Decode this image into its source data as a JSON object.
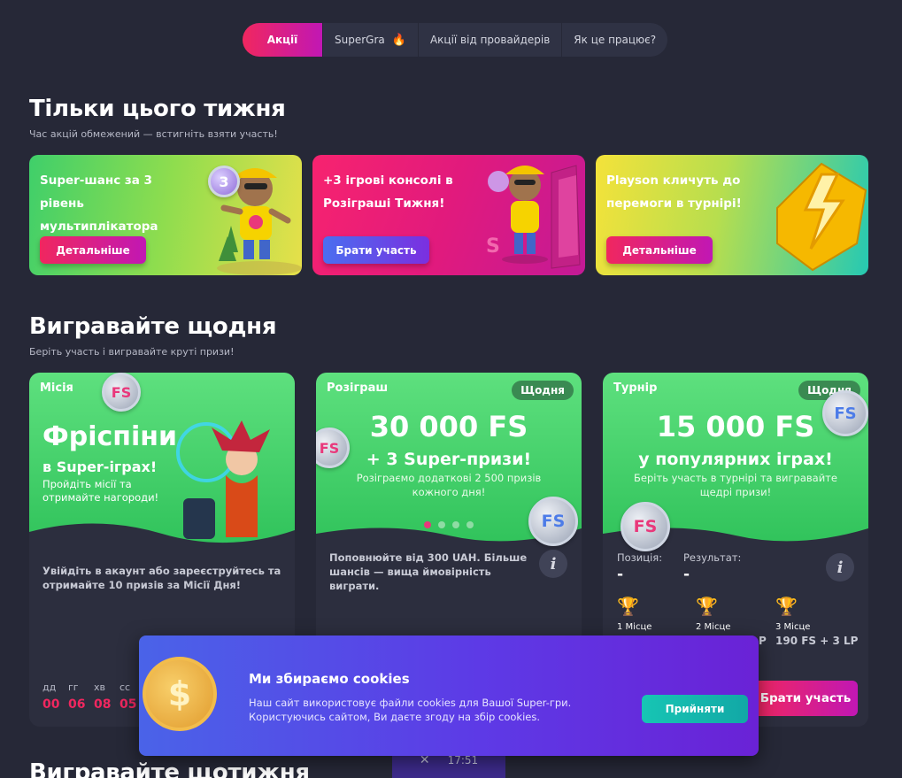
{
  "tabs": [
    {
      "label": "Акції",
      "active": true
    },
    {
      "label": "SuperGra",
      "icon": "fire-icon"
    },
    {
      "label": "Акції від провайдерів"
    },
    {
      "label": "Як це працює?"
    }
  ],
  "weekly": {
    "title": "Тільки цього тижня",
    "subtitle": "Час акцій обмежений — встигніть взяти участь!",
    "promos": [
      {
        "title": "Super-шанс за 3 рівень мультиплікатора двічі!",
        "button": "Детальніше",
        "mascot_badge": "3"
      },
      {
        "title": "+3 ігрові консолі в Розіграші Тижня!",
        "button": "Брати участь"
      },
      {
        "title": "Playson кличуть до перемоги в турнірі!",
        "button": "Детальніше"
      }
    ]
  },
  "daily": {
    "title": "Вигравайте щодня",
    "subtitle": "Беріть участь і вигравайте круті призи!",
    "mission": {
      "tag": "Місія",
      "headline": "Фріспіни",
      "line2": "в Super-іграх!",
      "line3": "Пройдіть місії та",
      "line4": "отримайте нагороди!",
      "body": "Увійдіть в акаунт або зареєструйтесь та отримайте 10 призів за Місії Дня!",
      "countdown": {
        "labels": [
          "дд",
          "гг",
          "хв",
          "сс"
        ],
        "values": [
          "00",
          "06",
          "08",
          "05"
        ]
      },
      "coin": "FS"
    },
    "raffle": {
      "tag": "Розіграш",
      "badge": "Щодня",
      "headline": "30 000 FS",
      "line2": "+ 3 Super-призи!",
      "line3": "Розіграємо додаткові 2 500 призів",
      "line4": "кожного дня!",
      "body": "Поповнюйте від 300 UAH. Більше шансів — вища ймовірність виграти.",
      "coin": "FS"
    },
    "tournament": {
      "tag": "Турнір",
      "badge": "Щодня",
      "headline": "15 000 FS",
      "line2": "у популярних іграх!",
      "line3": "Беріть участь в турнірі та вигравайте",
      "line4": "щедрі призи!",
      "position_label": "Позиція:",
      "position_value": "-",
      "result_label": "Результат:",
      "result_value": "-",
      "places": [
        {
          "label": "1 Місце",
          "prize": ""
        },
        {
          "label": "2 Місце",
          "prize": "P"
        },
        {
          "label": "3 Місце",
          "prize": "190 FS + 3 LP"
        }
      ],
      "button": "Брати участь",
      "coin": "FS"
    }
  },
  "next_section_title": "Вигравайте щотижня",
  "cookie": {
    "title": "Ми збираємо cookies",
    "text1": "Наш сайт використовує файли cookies для Вашої Super-гри.",
    "text2": "Користуючись сайтом, Ви даєте згоду на збір cookies.",
    "button": "Прийняти",
    "cookie_symbol": "$"
  },
  "floating_bar": {
    "close": "✕",
    "time": "17:51"
  },
  "colors": {
    "background": "#262837",
    "accent_pink": "#f0275f",
    "accent_purple": "#7b1fd6",
    "green": "#3ccf68"
  }
}
